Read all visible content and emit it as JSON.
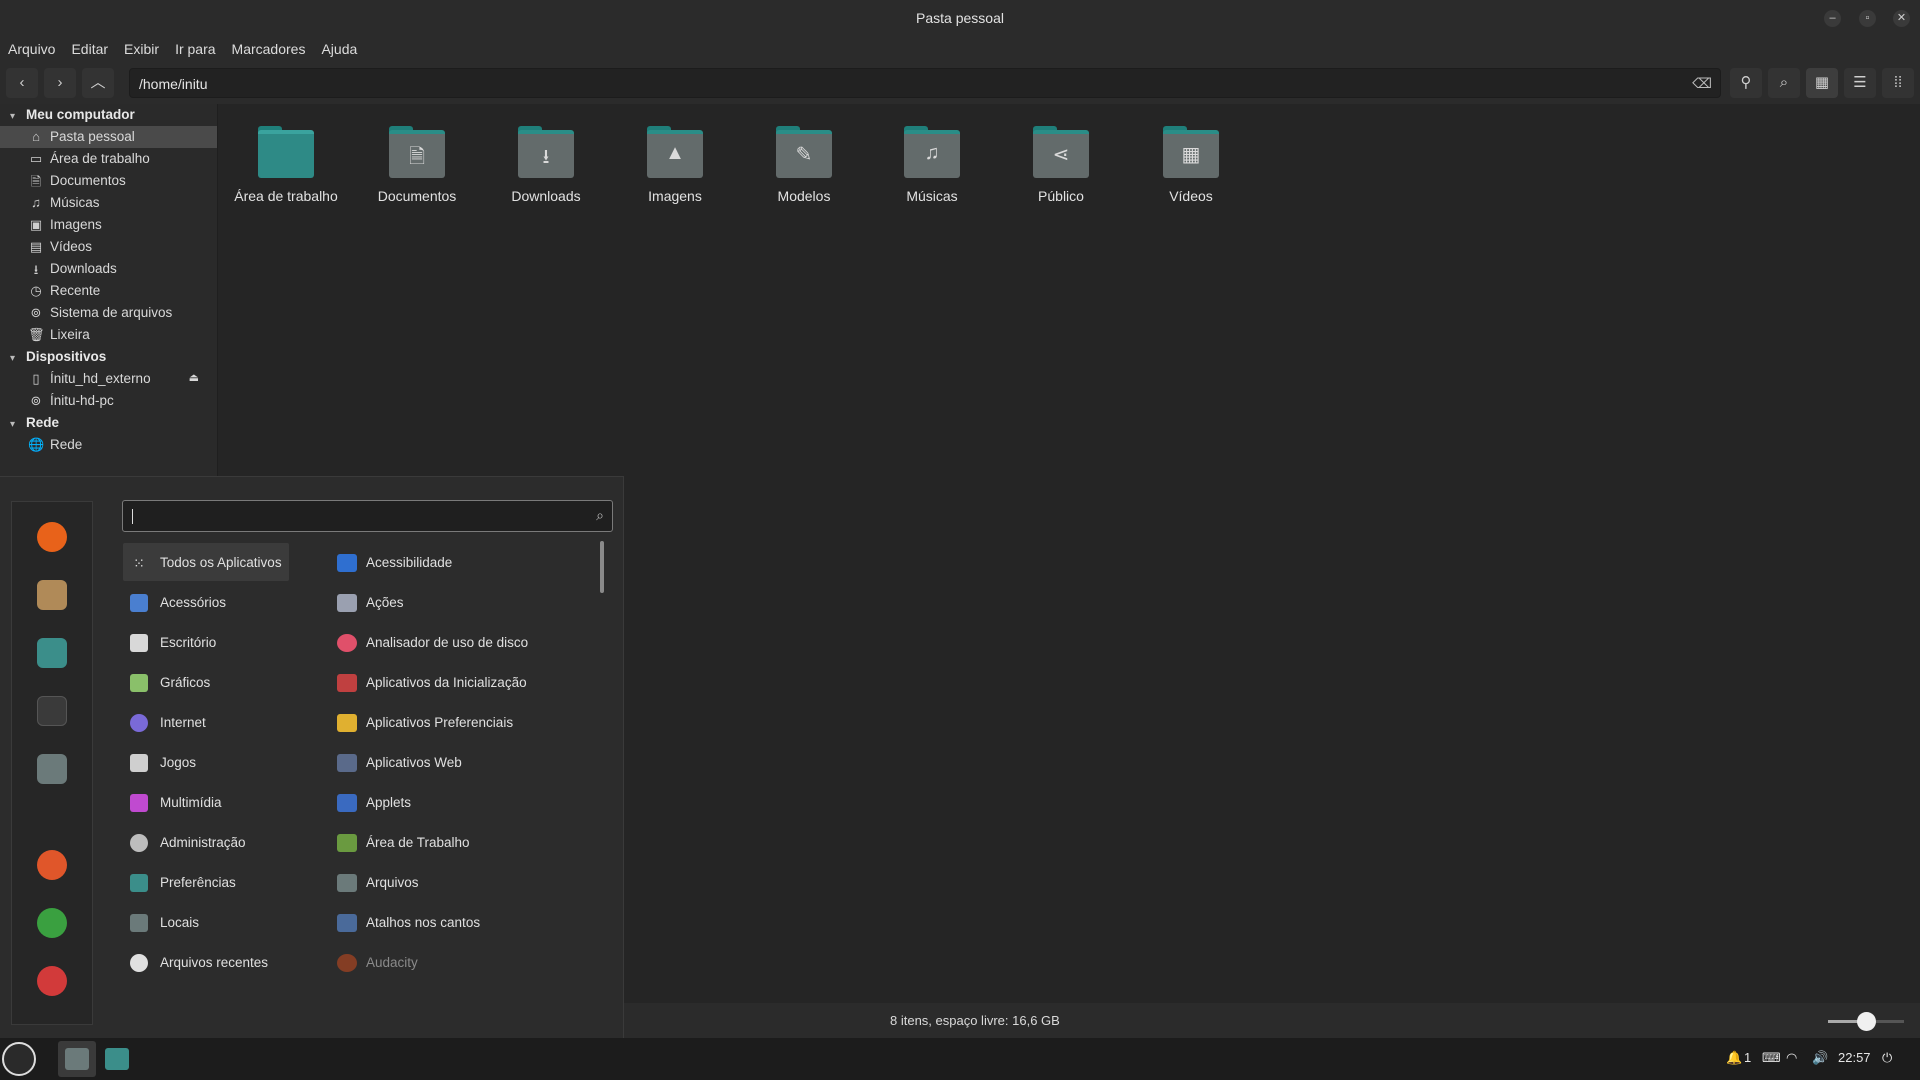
{
  "window": {
    "title": "Pasta pessoal",
    "buttons": {
      "minimize": "–",
      "maximize": "▫",
      "close": "✕"
    }
  },
  "menubar": [
    "Arquivo",
    "Editar",
    "Exibir",
    "Ir para",
    "Marcadores",
    "Ajuda"
  ],
  "toolbar": {
    "path": "/home/initu",
    "icons": [
      "back-icon",
      "forward-icon",
      "up-icon",
      "clear-icon",
      "location-icon",
      "search-icon",
      "icon-view-icon",
      "list-view-icon",
      "compact-view-icon"
    ]
  },
  "sidebar": {
    "sections": [
      {
        "title": "Meu computador",
        "items": [
          {
            "label": "Pasta pessoal",
            "icon": "home-icon",
            "selected": true
          },
          {
            "label": "Área de trabalho",
            "icon": "desktop-icon"
          },
          {
            "label": "Documentos",
            "icon": "document-icon"
          },
          {
            "label": "Músicas",
            "icon": "music-icon"
          },
          {
            "label": "Imagens",
            "icon": "image-icon"
          },
          {
            "label": "Vídeos",
            "icon": "video-icon"
          },
          {
            "label": "Downloads",
            "icon": "download-icon"
          },
          {
            "label": "Recente",
            "icon": "recent-icon"
          },
          {
            "label": "Sistema de arquivos",
            "icon": "filesystem-icon"
          },
          {
            "label": "Lixeira",
            "icon": "trash-icon"
          }
        ]
      },
      {
        "title": "Dispositivos",
        "items": [
          {
            "label": "Ínitu_hd_externo",
            "icon": "usb-drive-icon",
            "eject": true
          },
          {
            "label": "Ínitu-hd-pc",
            "icon": "drive-icon"
          }
        ]
      },
      {
        "title": "Rede",
        "items": [
          {
            "label": "Rede",
            "icon": "network-icon"
          }
        ]
      }
    ]
  },
  "folders": [
    {
      "label": "Área de trabalho",
      "icon": "desktop-folder-icon",
      "glyph": ""
    },
    {
      "label": "Documentos",
      "icon": "documents-folder-icon",
      "glyph": "🗎"
    },
    {
      "label": "Downloads",
      "icon": "downloads-folder-icon",
      "glyph": "⭳"
    },
    {
      "label": "Imagens",
      "icon": "pictures-folder-icon",
      "glyph": "▲"
    },
    {
      "label": "Modelos",
      "icon": "templates-folder-icon",
      "glyph": "✎"
    },
    {
      "label": "Músicas",
      "icon": "music-folder-icon",
      "glyph": "♫"
    },
    {
      "label": "Público",
      "icon": "public-folder-icon",
      "glyph": "⋖"
    },
    {
      "label": "Vídeos",
      "icon": "videos-folder-icon",
      "glyph": "▦"
    }
  ],
  "status": {
    "text": "8 itens, espaço livre: 16,6 GB",
    "zoom_level": 0.5
  },
  "app_menu": {
    "search_placeholder": "",
    "favorites": [
      {
        "name": "firefox-icon",
        "color": "#e8621a"
      },
      {
        "name": "package-manager-icon",
        "color": "#b08a58"
      },
      {
        "name": "settings-icon",
        "color": "#3b8e8a"
      },
      {
        "name": "terminal-icon",
        "color": "#3a3a3a"
      },
      {
        "name": "files-icon",
        "color": "#6b7a7a"
      },
      {
        "name": "lock-screen-icon",
        "color": "#e0562a"
      },
      {
        "name": "logout-icon",
        "color": "#3aa040"
      },
      {
        "name": "power-icon",
        "color": "#d23a3a"
      }
    ],
    "categories": [
      {
        "label": "Todos os Aplicativos",
        "color": "#cccccc",
        "selected": true
      },
      {
        "label": "Acessórios",
        "color": "#4a7fd0"
      },
      {
        "label": "Escritório",
        "color": "#d8d8d8"
      },
      {
        "label": "Gráficos",
        "color": "#8ac06a"
      },
      {
        "label": "Internet",
        "color": "#7a6ad8"
      },
      {
        "label": "Jogos",
        "color": "#cfcfcf"
      },
      {
        "label": "Multimídia",
        "color": "#c04ad0"
      },
      {
        "label": "Administração",
        "color": "#bdbdbd"
      },
      {
        "label": "Preferências",
        "color": "#3b8e8a"
      },
      {
        "label": "Locais",
        "color": "#6b7a7a"
      },
      {
        "label": "Arquivos recentes",
        "color": "#e0e0e0"
      }
    ],
    "apps": [
      {
        "label": "Acessibilidade",
        "color": "#2f6fd0"
      },
      {
        "label": "Ações",
        "color": "#9aa0b0"
      },
      {
        "label": "Analisador de uso de disco",
        "color": "#e0506a"
      },
      {
        "label": "Aplicativos da Inicialização",
        "color": "#c04040"
      },
      {
        "label": "Aplicativos Preferenciais",
        "color": "#e0b030"
      },
      {
        "label": "Aplicativos Web",
        "color": "#5a6a8a"
      },
      {
        "label": "Applets",
        "color": "#3a6ac0"
      },
      {
        "label": "Área de Trabalho",
        "color": "#6a9a40"
      },
      {
        "label": "Arquivos",
        "color": "#6b7a7a"
      },
      {
        "label": "Atalhos nos cantos",
        "color": "#4a6a9a"
      },
      {
        "label": "Audacity",
        "color": "#c04a20",
        "dim": true
      }
    ]
  },
  "taskbar": {
    "apps": [
      "menu-icon",
      "files-icon",
      "settings-icon"
    ],
    "tray": {
      "notifications": "1",
      "time": "22:57"
    }
  }
}
